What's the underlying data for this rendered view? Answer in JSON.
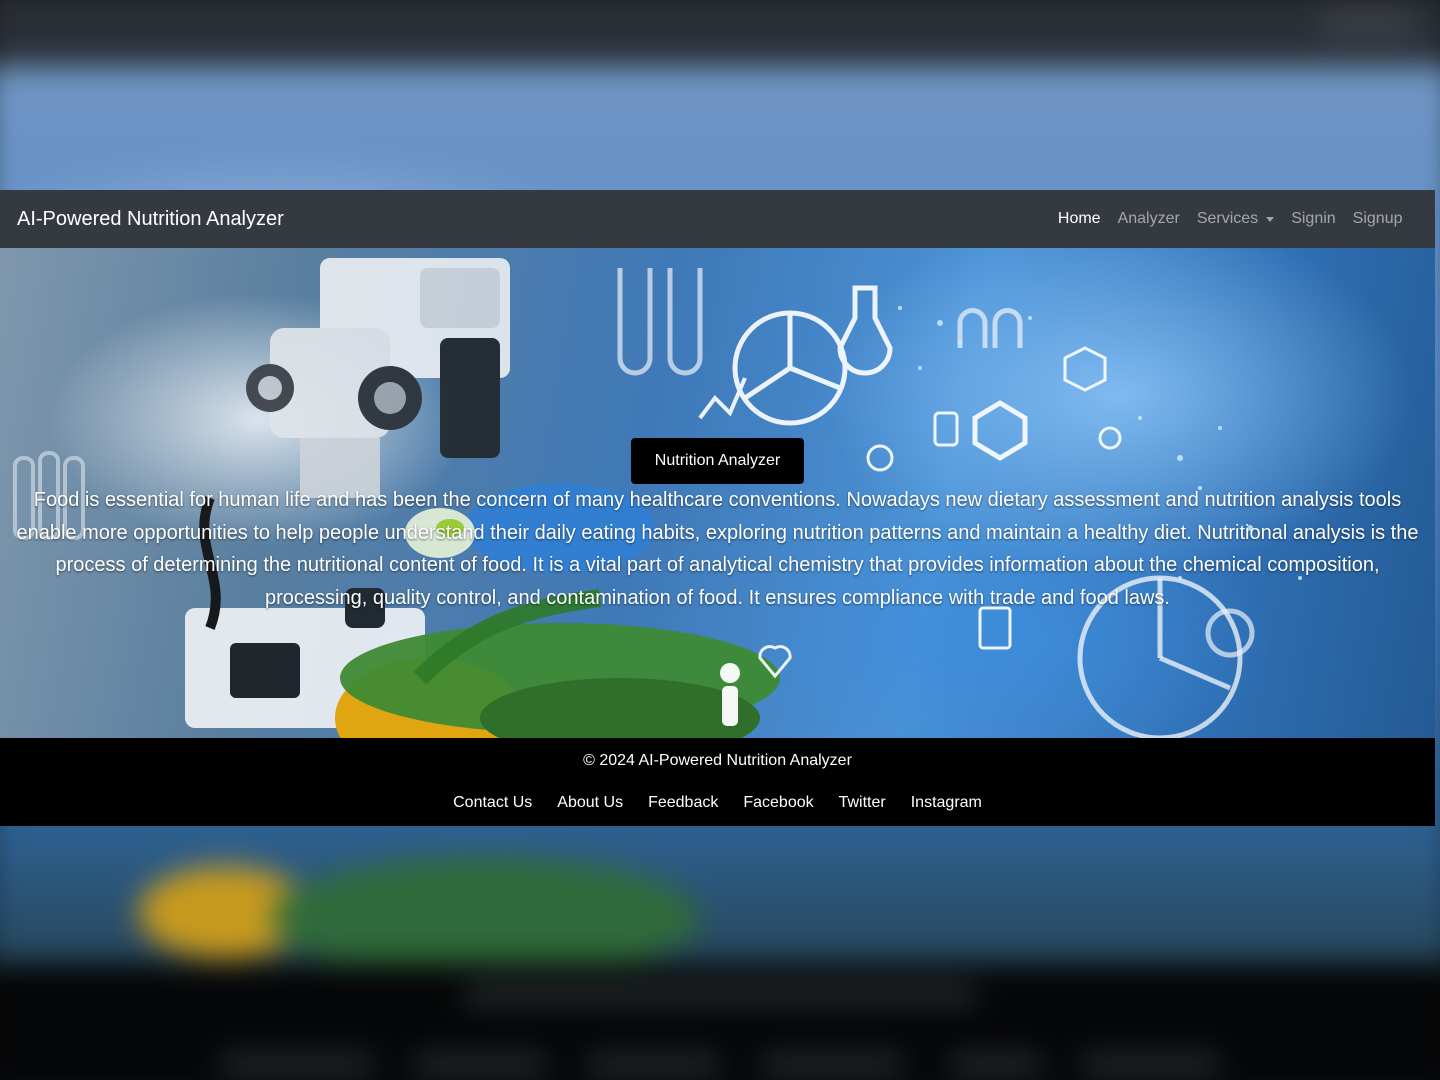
{
  "navbar": {
    "brand": "AI-Powered Nutrition Analyzer",
    "links": [
      {
        "label": "Home",
        "active": true
      },
      {
        "label": "Analyzer",
        "active": false
      },
      {
        "label": "Services",
        "active": false,
        "dropdown": true
      },
      {
        "label": "Signin",
        "active": false
      },
      {
        "label": "Signup",
        "active": false
      }
    ]
  },
  "hero": {
    "button_label": "Nutrition Analyzer",
    "paragraph": "Food is essential for human life and has been the concern of many healthcare conventions. Nowadays new dietary assessment and nutrition analysis tools enable more opportunities to help people understand their daily eating habits, exploring nutrition patterns and maintain a healthy diet. Nutritional analysis is the process of determining the nutritional content of food. It is a vital part of analytical chemistry that provides information about the chemical composition, processing, quality control, and contamination of food. It ensures compliance with trade and food laws."
  },
  "footer": {
    "copyright": "© 2024 AI-Powered Nutrition Analyzer",
    "links": [
      "Contact Us",
      "About Us",
      "Feedback",
      "Facebook",
      "Twitter",
      "Instagram"
    ]
  },
  "colors": {
    "navbar_bg": "#343a40",
    "footer_bg": "#000000",
    "button_bg": "#000000",
    "text": "#ffffff"
  },
  "icons": [
    "caret-down-icon",
    "flask-icon",
    "pie-chart-icon",
    "molecule-icon",
    "person-icon",
    "heart-icon"
  ]
}
